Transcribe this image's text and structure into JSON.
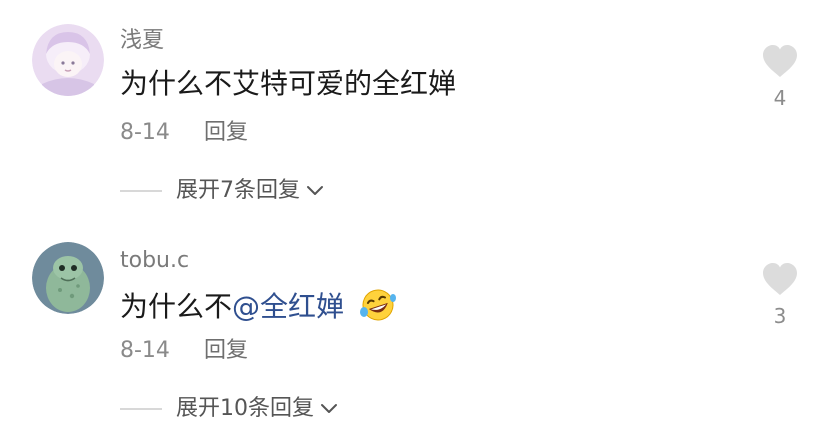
{
  "comments": [
    {
      "username": "浅夏",
      "text": "为什么不艾特可爱的全红婵",
      "date": "8-14",
      "reply_label": "回复",
      "likes": "4",
      "expand_label": "展开7条回复"
    },
    {
      "username": "tobu.c",
      "text_prefix": "为什么不",
      "mention": "@全红婵",
      "date": "8-14",
      "reply_label": "回复",
      "likes": "3",
      "expand_label": "展开10条回复"
    }
  ],
  "icons": {
    "like": "heart-icon",
    "expand": "chevron-down-icon",
    "emoji": "laughing-tears-emoji-icon"
  },
  "colors": {
    "mention": "#2f4f8f",
    "like_heart": "#dcdcdc"
  }
}
